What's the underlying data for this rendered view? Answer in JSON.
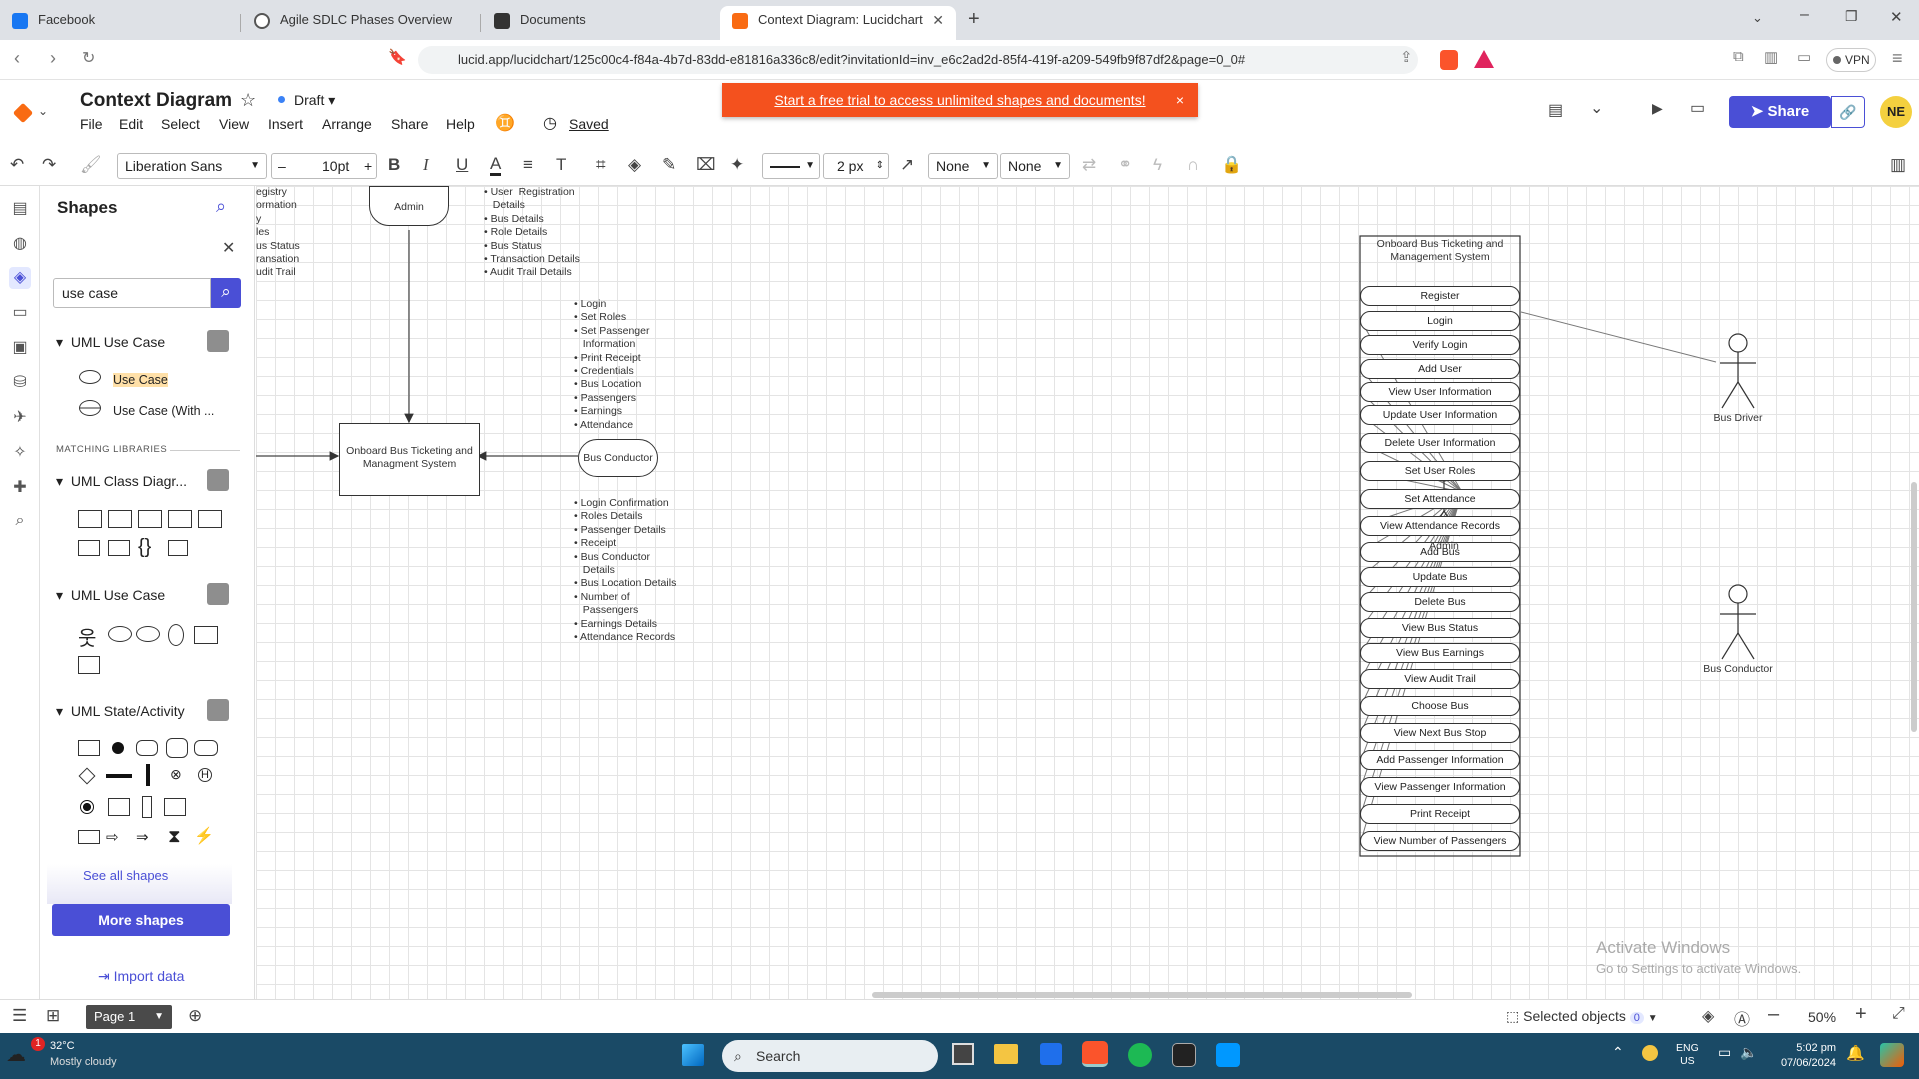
{
  "browser": {
    "tabs": [
      {
        "label": "Facebook",
        "active": false
      },
      {
        "label": "Agile SDLC Phases Overview",
        "active": false
      },
      {
        "label": "Documents",
        "active": false
      },
      {
        "label": "Context Diagram: Lucidchart",
        "active": true
      }
    ],
    "new_tab": "+",
    "url": "lucid.app/lucidchart/125c00c4-f84a-4b7d-83dd-e81816a336c8/edit?invitationId=inv_e6c2ad2d-85f4-419f-a209-549fb9f87df2&page=0_0#",
    "vpn_label": "VPN"
  },
  "app": {
    "title": "Context Diagram",
    "draft_label": "Draft",
    "menu": [
      "File",
      "Edit",
      "Select",
      "View",
      "Insert",
      "Arrange",
      "Share",
      "Help"
    ],
    "saved_label": "Saved",
    "banner": "Start a free trial to access unlimited shapes and documents!",
    "banner_close": "×",
    "share_label": "Share",
    "avatar_initials": "NE"
  },
  "toolbar": {
    "font": "Liberation Sans",
    "font_size": "10pt",
    "line_width": "2 px",
    "arrow_start": "None",
    "arrow_end": "None"
  },
  "shapes_panel": {
    "title": "Shapes",
    "search_value": "use case",
    "library1": "UML Use Case",
    "item1": "Use Case",
    "item2": "Use Case (With ...",
    "matching_label": "MATCHING LIBRARIES",
    "lib_class": "UML Class Diagr...",
    "lib_usecase": "UML Use Case",
    "lib_state": "UML State/Activity",
    "see_all": "See all shapes",
    "more_shapes": "More shapes",
    "import_data": "Import data"
  },
  "context_diagram": {
    "system_label": "Onboard Bus Ticketing and Managment System",
    "admin": "Admin",
    "bus_conductor": "Bus Conductor",
    "left_cut_list": "egistry\normation\ny\nles\nus Status\nransation\nudit Trail",
    "admin_out_list": "• User  Registration\n   Details\n• Bus Details\n• Role Details\n• Bus Status\n• Transaction Details\n• Audit Trail Details",
    "conductor_in_list": "• Login\n• Set Roles\n• Set Passenger\n   Information\n• Print Receipt\n• Credentials\n• Bus Location\n• Passengers\n• Earnings\n• Attendance",
    "conductor_out_list": "• Login Confirmation\n• Roles Details\n• Passenger Details\n• Receipt\n• Bus Conductor\n   Details\n• Bus Location Details\n• Number of\n   Passengers\n• Earnings Details\n• Attendance Records"
  },
  "use_case_diagram": {
    "system_title": "Onboard Bus Ticketing and Management System",
    "use_cases": [
      "Register",
      "Login",
      "Verify Login",
      "Add User",
      "View User Information",
      "Update User Information",
      "Delete User Information",
      "Set User Roles",
      "Set Attendance",
      "View Attendance Records",
      "Add Bus",
      "Update Bus",
      "Delete Bus",
      "View Bus Status",
      "View Bus Earnings",
      "View Audit Trail",
      "Choose Bus",
      "View Next Bus Stop",
      "Add Passenger Information",
      "View Passenger Information",
      "Print Receipt",
      "View Number of Passengers"
    ],
    "actors": {
      "admin": "Admin",
      "bus_driver": "Bus Driver",
      "bus_conductor": "Bus Conductor"
    }
  },
  "watermark": {
    "title": "Activate Windows",
    "sub": "Go to Settings to activate Windows."
  },
  "bottom": {
    "page": "Page 1",
    "selected": "Selected objects",
    "selected_count": "0",
    "zoom": "50%"
  },
  "taskbar": {
    "temp": "32°C",
    "weather": "Mostly cloudy",
    "search": "Search",
    "lang": "ENG",
    "region": "US",
    "time": "5:02 pm",
    "date": "07/06/2024"
  },
  "colors": {
    "accent": "#4a4fd6",
    "banner": "#f4511e",
    "brand": "#f96b13",
    "taskbar": "#1a4a66"
  }
}
